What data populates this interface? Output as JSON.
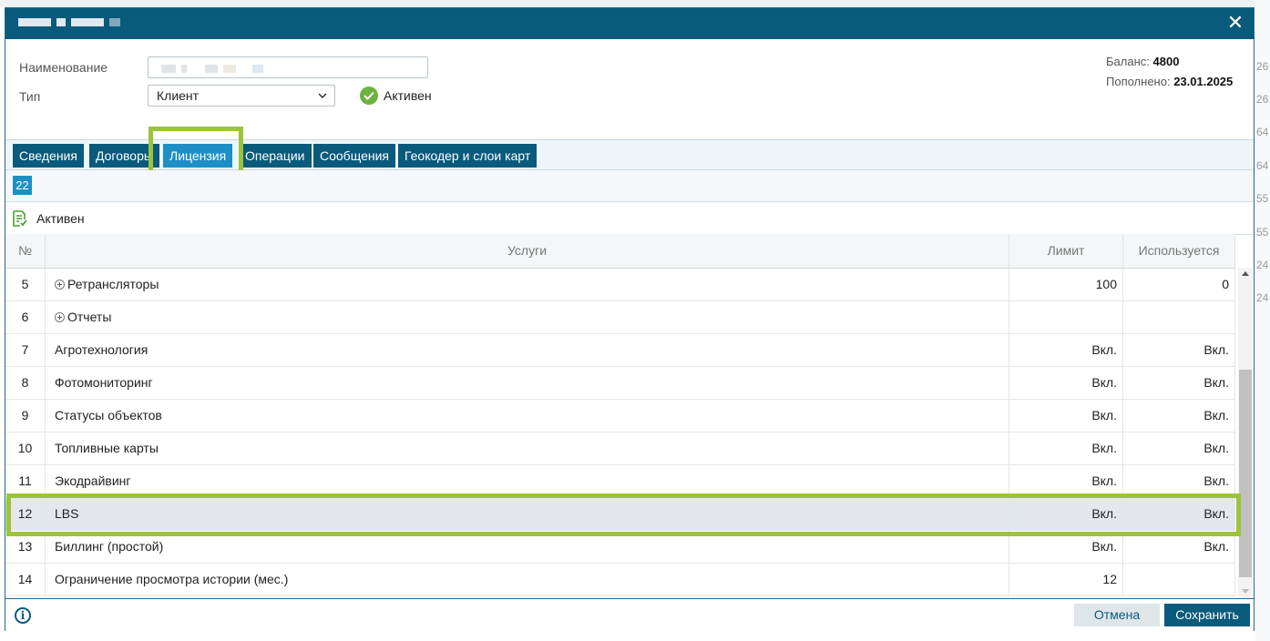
{
  "background": {
    "right_edge_numbers": [
      "26",
      "26",
      "64",
      "64",
      "55",
      "55",
      "24",
      "24"
    ]
  },
  "dialog": {
    "close_icon": "close-icon",
    "header": {
      "name_label": "Наименование",
      "type_label": "Тип",
      "type_value": "Клиент",
      "active_label": "Активен",
      "balance_label": "Баланс:",
      "balance_value": "4800",
      "topup_label": "Пополнено:",
      "topup_value": "23.01.2025"
    },
    "tabs": [
      {
        "label": "Сведения"
      },
      {
        "label": "Договоры"
      },
      {
        "label": "Лицензия"
      },
      {
        "label": "Операции"
      },
      {
        "label": "Сообщения"
      },
      {
        "label": "Геокодер и слои карт"
      }
    ],
    "active_tab": "Лицензия",
    "badge": "22",
    "status": "Активен",
    "table": {
      "columns": [
        "№",
        "Услуги",
        "Лимит",
        "Используется"
      ],
      "rows": [
        {
          "num": "5",
          "service": "Ретрансляторы",
          "limit": "100",
          "used": "0",
          "expandable": true
        },
        {
          "num": "6",
          "service": "Отчеты",
          "limit": "",
          "used": "",
          "expandable": true
        },
        {
          "num": "7",
          "service": "Агротехнология",
          "limit": "Вкл.",
          "used": "Вкл."
        },
        {
          "num": "8",
          "service": "Фотомониторинг",
          "limit": "Вкл.",
          "used": "Вкл."
        },
        {
          "num": "9",
          "service": "Статусы объектов",
          "limit": "Вкл.",
          "used": "Вкл."
        },
        {
          "num": "10",
          "service": "Топливные карты",
          "limit": "Вкл.",
          "used": "Вкл."
        },
        {
          "num": "11",
          "service": "Экодрайвинг",
          "limit": "Вкл.",
          "used": "Вкл."
        },
        {
          "num": "12",
          "service": "LBS",
          "limit": "Вкл.",
          "used": "Вкл.",
          "selected": true
        },
        {
          "num": "13",
          "service": "Биллинг (простой)",
          "limit": "Вкл.",
          "used": "Вкл."
        },
        {
          "num": "14",
          "service": "Ограничение просмотра истории (мес.)",
          "limit": "12",
          "used": ""
        }
      ]
    },
    "footer": {
      "info_icon": "info-icon",
      "cancel_label": "Отмена",
      "save_label": "Сохранить"
    }
  },
  "colors": {
    "titlebar": "#0a5a7c",
    "tab": "#0a5a7c",
    "tab_active": "#1e8fc5",
    "highlight": "#9cc43b",
    "active_check": "#6cb33f"
  }
}
